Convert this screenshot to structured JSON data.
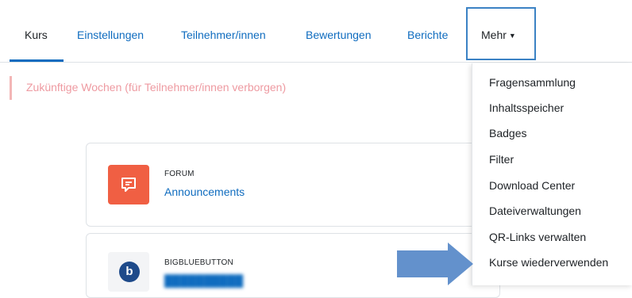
{
  "nav": {
    "tabs": [
      {
        "label": "Kurs",
        "active": true
      },
      {
        "label": "Einstellungen"
      },
      {
        "label": "Teilnehmer/innen"
      },
      {
        "label": "Bewertungen"
      },
      {
        "label": "Berichte"
      }
    ],
    "more": {
      "label": "Mehr",
      "icon": "chevron-down-icon"
    }
  },
  "section": {
    "title": "Zukünftige Wochen (für Teilnehmer/innen verborgen)"
  },
  "activities": [
    {
      "type": "FORUM",
      "title": "Announcements",
      "icon": "forum-icon",
      "icon_color": "#f05f43"
    },
    {
      "type": "BIGBLUEBUTTON",
      "icon": "bigbluebutton-icon",
      "icon_color": "#1e4a8a"
    }
  ],
  "dropdown": {
    "items": [
      "Fragensammlung",
      "Inhaltsspeicher",
      "Badges",
      "Filter",
      "Download Center",
      "Dateiverwaltungen",
      "QR-Links verwalten",
      "Kurse wiederverwenden"
    ]
  },
  "colors": {
    "link": "#0f6cbf",
    "accent_box": "#3b82c4",
    "arrow": "#5b8bc9",
    "hidden_text": "#ee9aa1"
  }
}
